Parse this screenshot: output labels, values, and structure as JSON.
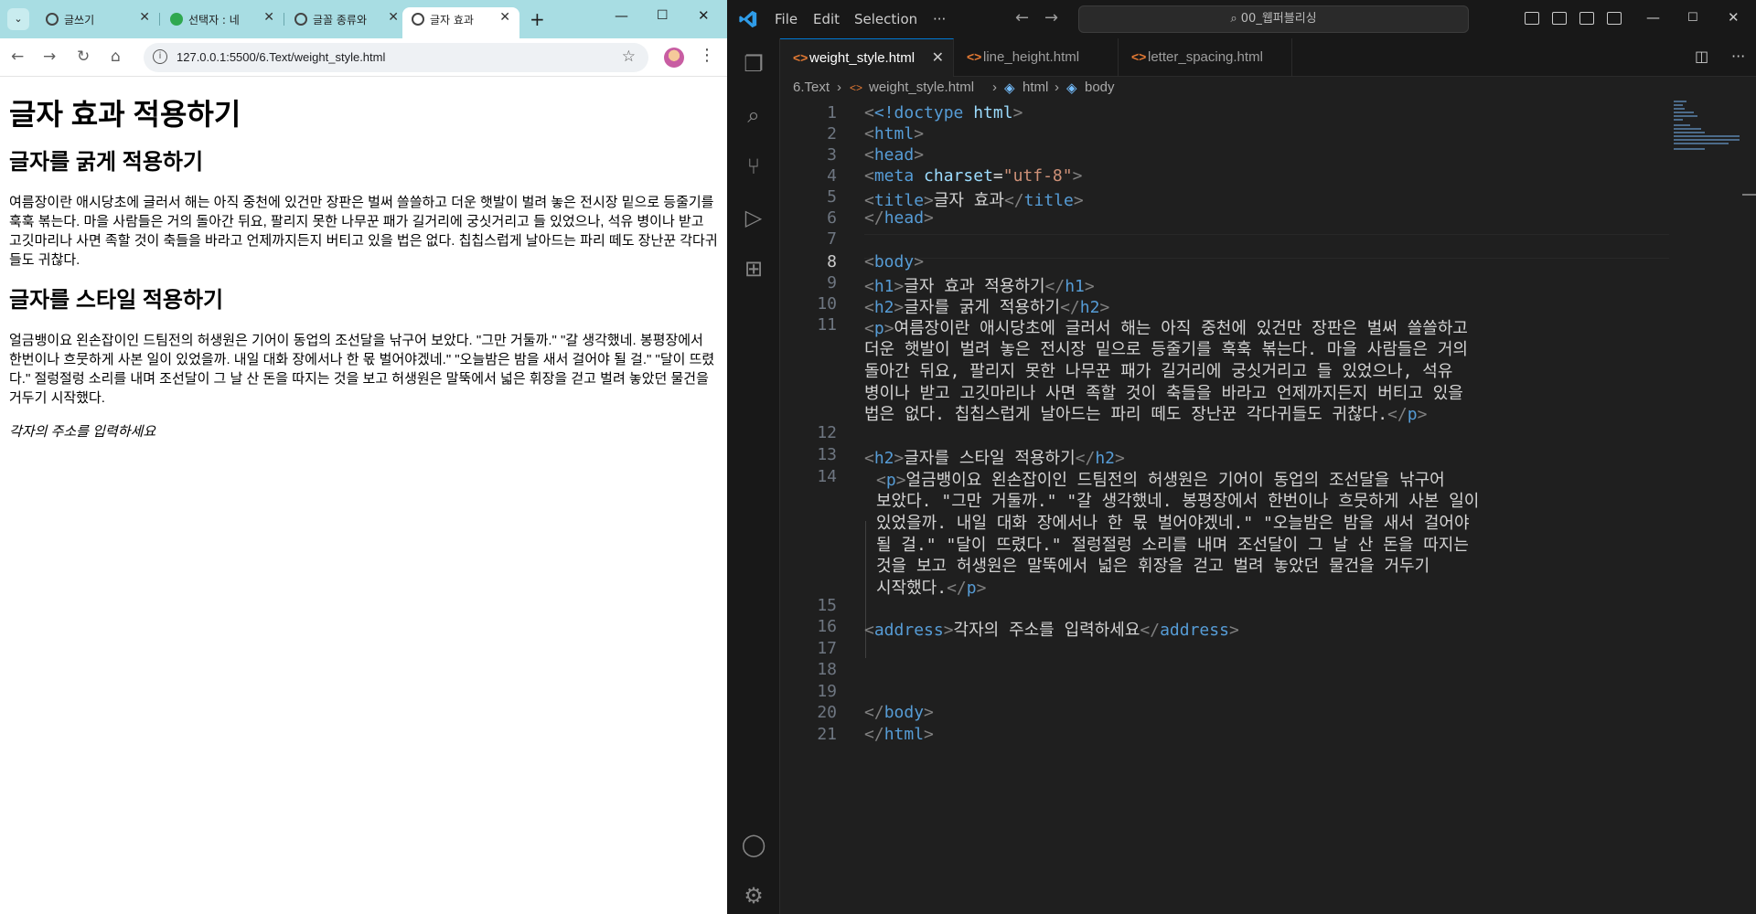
{
  "browser": {
    "tabs": [
      {
        "label": "글쓰기",
        "favicon": "globe-icon"
      },
      {
        "label": "선택자 : 네",
        "favicon": "green-leaf-icon"
      },
      {
        "label": "글꼴 종류와",
        "favicon": "globe-icon"
      },
      {
        "label": "글자 효과",
        "favicon": "globe-icon",
        "active": true
      }
    ],
    "new_tab": "+",
    "url": "127.0.0.1:5500/6.Text/weight_style.html",
    "page": {
      "h1": "글자 효과 적용하기",
      "h2_bold": "글자를 굵게 적용하기",
      "p1": "여름장이란 애시당초에 글러서 해는 아직 중천에 있건만 장판은 벌써 쓸쓸하고 더운 햇발이 벌려 놓은 전시장 밑으로 등줄기를 훅훅 볶는다. 마을 사람들은 거의 돌아간 뒤요, 팔리지 못한 나무꾼 패가 길거리에 궁싯거리고 들 있었으나, 석유 병이나 받고 고깃마리나 사면 족할 것이 축들을 바라고 언제까지든지 버티고 있을 법은 없다. 칩칩스럽게 날아드는 파리 떼도 장난꾼 각다귀들도 귀찮다.",
      "h2_style": "글자를 스타일 적용하기",
      "p2": "얼금뱅이요 왼손잡이인 드팀전의 허생원은 기어이 동업의 조선달을 낚구어 보았다. \"그만 거둘까.\" \"갈 생각했네. 봉평장에서 한번이나 흐뭇하게 사본 일이 있었을까. 내일 대화 장에서나 한 몫 벌어야겠네.\" \"오늘밤은 밤을 새서 걸어야 될 걸.\" \"달이 뜨렸다.\" 절렁절렁 소리를 내며 조선달이 그 날 산 돈을 따지는 것을 보고 허생원은 말뚝에서 넓은 휘장을 걷고 벌려 놓았던 물건을 거두기 시작했다.",
      "address": "각자의 주소를 입력하세요"
    }
  },
  "vscode": {
    "menu": [
      "File",
      "Edit",
      "Selection",
      "···"
    ],
    "command_center": "00_웹퍼블리싱",
    "tabs": [
      {
        "label": "weight_style.html",
        "active": true
      },
      {
        "label": "line_height.html"
      },
      {
        "label": "letter_spacing.html"
      }
    ],
    "breadcrumb": [
      "6.Text",
      "weight_style.html",
      "html",
      "body"
    ],
    "line_numbers": [
      "1",
      "2",
      "3",
      "4",
      "5",
      "6",
      "7",
      "8",
      "9",
      "10",
      "11",
      "12",
      "13",
      "14",
      "15",
      "16",
      "17",
      "18",
      "19",
      "20",
      "21"
    ],
    "code": {
      "l1_doctype": "<!doctype ",
      "l1_html": "html",
      "l1_end": ">",
      "l4_attr": "charset",
      "l4_val": "\"utf-8\"",
      "l5_text": "글자 효과",
      "l9_text": "글자 효과 적용하기",
      "l10_text": "글자를 굵게 적용하기",
      "l11_w1": "여름장이란 애시당초에 글러서 해는 아직 중천에 있건만 장판은 벌써 쓸쓸하고",
      "l11_w2": "더운 햇발이 벌려 놓은 전시장 밑으로 등줄기를 훅훅 볶는다. 마을 사람들은 거의",
      "l11_w3": "돌아간 뒤요, 팔리지 못한 나무꾼 패가 길거리에 궁싯거리고 들 있었으나, 석유",
      "l11_w4": "병이나 받고 고깃마리나 사면 족할 것이 축들을 바라고 언제까지든지 버티고 있을",
      "l11_w5": "법은 없다. 칩칩스럽게 날아드는 파리 떼도 장난꾼 각다귀들도 귀찮다.",
      "l13_text": "글자를 스타일 적용하기",
      "l14_w1": "얼금뱅이요 왼손잡이인 드팀전의 허생원은 기어이 동업의 조선달을 낚구어",
      "l14_w2": "보았다. \"그만 거둘까.\" \"갈 생각했네. 봉평장에서 한번이나 흐뭇하게 사본 일이",
      "l14_w3": "있었을까. 내일 대화 장에서나 한 몫 벌어야겠네.\" \"오늘밤은 밤을 새서 걸어야",
      "l14_w4": "될 걸.\" \"달이 뜨렸다.\" 절렁절렁 소리를 내며 조선달이 그 날 산 돈을 따지는",
      "l14_w5": "것을 보고 허생원은 말뚝에서 넓은 휘장을 걷고 벌려 놓았던 물건을 거두기",
      "l14_w6": "시작했다.",
      "l16_text": "각자의 주소를 입력하세요"
    },
    "colors": {
      "tag": "#569cd6",
      "bracket": "#808080",
      "attr": "#9cdcfe",
      "string": "#ce9178",
      "text": "#d4d4d4"
    }
  }
}
